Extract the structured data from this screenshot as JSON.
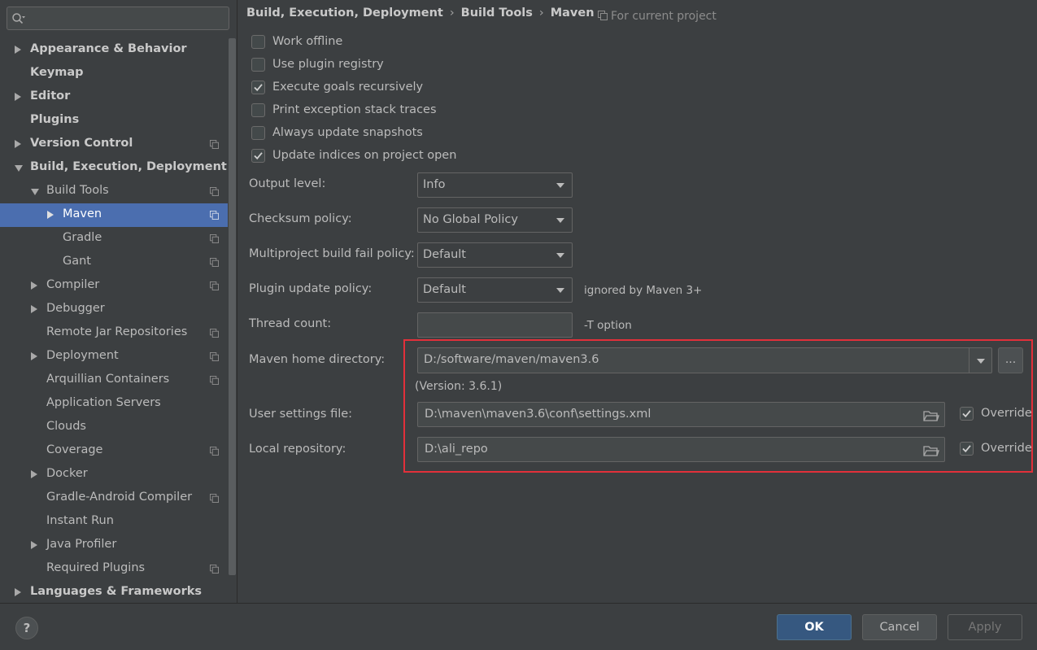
{
  "search": {
    "value": "",
    "placeholder": ""
  },
  "sidebar": {
    "items": [
      {
        "label": "Appearance & Behavior",
        "bold": true,
        "arrow": "right",
        "indent": 0,
        "project": false
      },
      {
        "label": "Keymap",
        "bold": true,
        "arrow": "",
        "indent": 0,
        "project": false
      },
      {
        "label": "Editor",
        "bold": true,
        "arrow": "right",
        "indent": 0,
        "project": false
      },
      {
        "label": "Plugins",
        "bold": true,
        "arrow": "",
        "indent": 0,
        "project": false
      },
      {
        "label": "Version Control",
        "bold": true,
        "arrow": "right",
        "indent": 0,
        "project": true
      },
      {
        "label": "Build, Execution, Deployment",
        "bold": true,
        "arrow": "down",
        "indent": 0,
        "project": false
      },
      {
        "label": "Build Tools",
        "bold": false,
        "arrow": "down",
        "indent": 1,
        "project": true
      },
      {
        "label": "Maven",
        "bold": false,
        "arrow": "right",
        "indent": 2,
        "project": true,
        "selected": true
      },
      {
        "label": "Gradle",
        "bold": false,
        "arrow": "",
        "indent": 2,
        "project": true
      },
      {
        "label": "Gant",
        "bold": false,
        "arrow": "",
        "indent": 2,
        "project": true
      },
      {
        "label": "Compiler",
        "bold": false,
        "arrow": "right",
        "indent": 1,
        "project": true
      },
      {
        "label": "Debugger",
        "bold": false,
        "arrow": "right",
        "indent": 1,
        "project": false
      },
      {
        "label": "Remote Jar Repositories",
        "bold": false,
        "arrow": "",
        "indent": 1,
        "project": true
      },
      {
        "label": "Deployment",
        "bold": false,
        "arrow": "right",
        "indent": 1,
        "project": true
      },
      {
        "label": "Arquillian Containers",
        "bold": false,
        "arrow": "",
        "indent": 1,
        "project": true
      },
      {
        "label": "Application Servers",
        "bold": false,
        "arrow": "",
        "indent": 1,
        "project": false
      },
      {
        "label": "Clouds",
        "bold": false,
        "arrow": "",
        "indent": 1,
        "project": false
      },
      {
        "label": "Coverage",
        "bold": false,
        "arrow": "",
        "indent": 1,
        "project": true
      },
      {
        "label": "Docker",
        "bold": false,
        "arrow": "right",
        "indent": 1,
        "project": false
      },
      {
        "label": "Gradle-Android Compiler",
        "bold": false,
        "arrow": "",
        "indent": 1,
        "project": true
      },
      {
        "label": "Instant Run",
        "bold": false,
        "arrow": "",
        "indent": 1,
        "project": false
      },
      {
        "label": "Java Profiler",
        "bold": false,
        "arrow": "right",
        "indent": 1,
        "project": false
      },
      {
        "label": "Required Plugins",
        "bold": false,
        "arrow": "",
        "indent": 1,
        "project": true
      },
      {
        "label": "Languages & Frameworks",
        "bold": true,
        "arrow": "right",
        "indent": 0,
        "project": false
      }
    ]
  },
  "breadcrumb": {
    "part1": "Build, Execution, Deployment",
    "part2": "Build Tools",
    "part3": "Maven",
    "sep": "›"
  },
  "scope_note": "For current project",
  "checkboxes": [
    {
      "label": "Work offline",
      "checked": false
    },
    {
      "label": "Use plugin registry",
      "checked": false
    },
    {
      "label": "Execute goals recursively",
      "checked": true
    },
    {
      "label": "Print exception stack traces",
      "checked": false
    },
    {
      "label": "Always update snapshots",
      "checked": false
    },
    {
      "label": "Update indices on project open",
      "checked": true
    }
  ],
  "form": {
    "output_level": {
      "label": "Output level:",
      "value": "Info"
    },
    "checksum_policy": {
      "label": "Checksum policy:",
      "value": "No Global Policy"
    },
    "multiproject_policy": {
      "label": "Multiproject build fail policy:",
      "value": "Default"
    },
    "plugin_update_policy": {
      "label": "Plugin update policy:",
      "value": "Default",
      "hint": "ignored by Maven 3+"
    },
    "thread_count": {
      "label": "Thread count:",
      "value": "",
      "hint": "-T option"
    },
    "maven_home": {
      "label": "Maven home directory:",
      "value": "D:/software/maven/maven3.6",
      "browse": "...",
      "version": "(Version: 3.6.1)"
    },
    "user_settings": {
      "label": "User settings file:",
      "value": "D:\\maven\\maven3.6\\conf\\settings.xml",
      "override_label": "Override",
      "override": true
    },
    "local_repo": {
      "label": "Local repository:",
      "value": "D:\\ali_repo",
      "override_label": "Override",
      "override": true
    }
  },
  "footer": {
    "help": "?",
    "ok": "OK",
    "cancel": "Cancel",
    "apply": "Apply"
  },
  "colors": {
    "selection": "#4b6eaf",
    "highlight_box": "#e2303a",
    "ok_button": "#365880"
  },
  "icons": {
    "search": "search-icon",
    "project_scope": "project-scope-icon",
    "folder": "folder-icon",
    "check": "check-icon"
  }
}
